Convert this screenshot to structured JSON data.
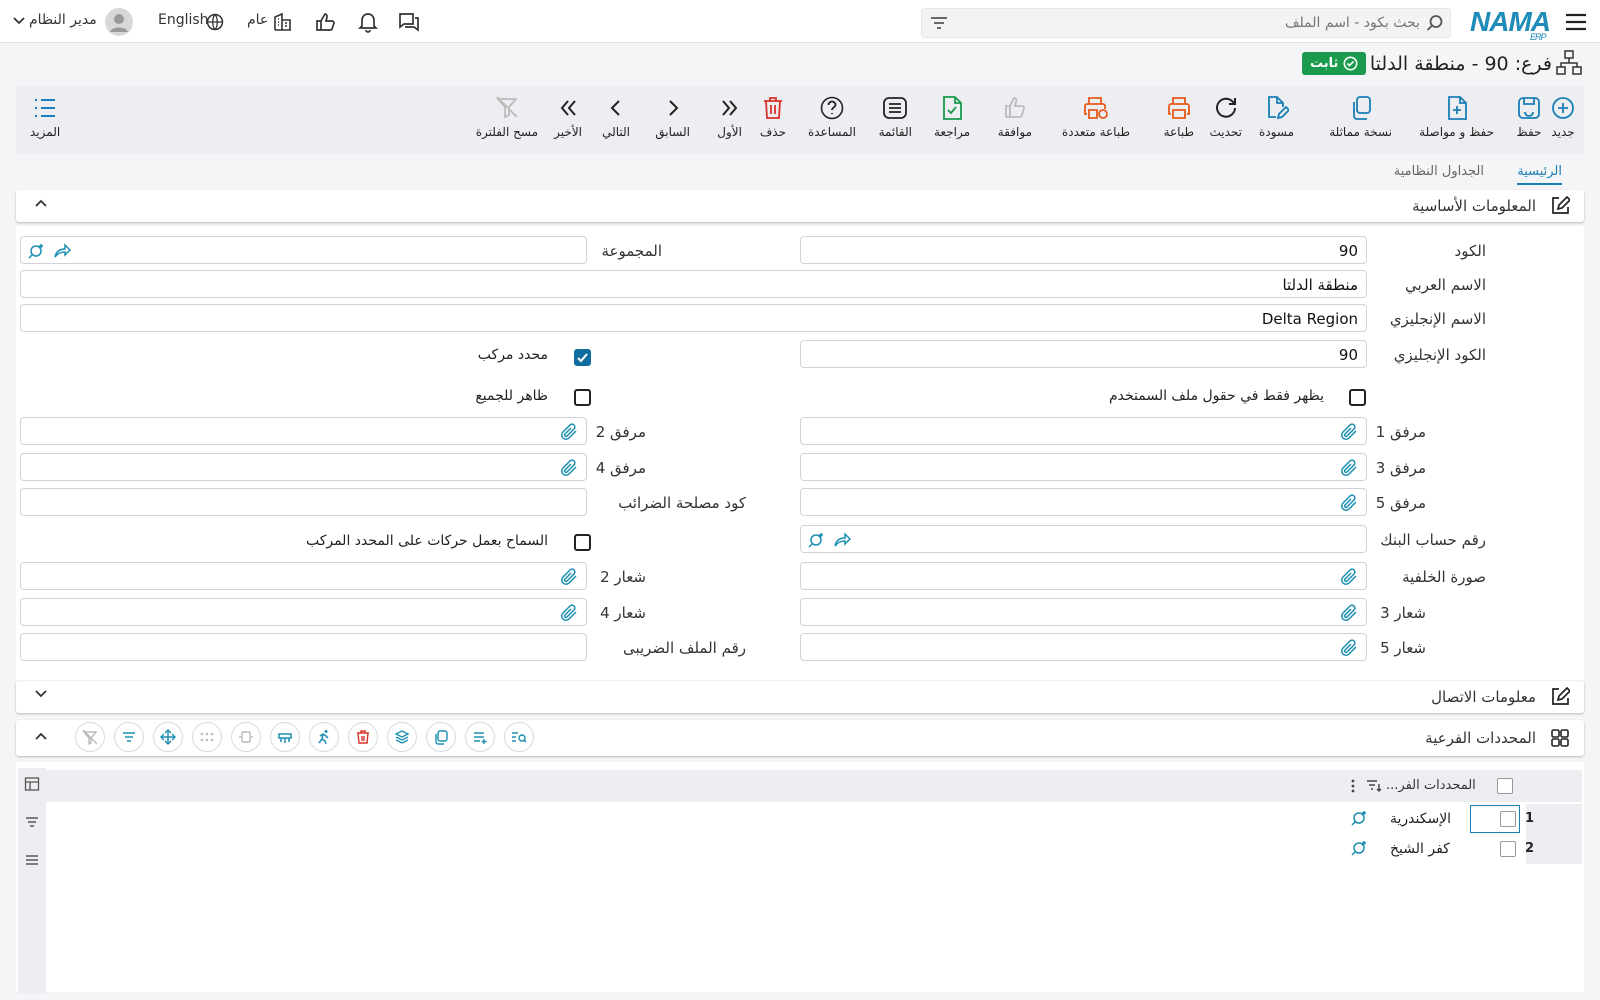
{
  "topbar": {
    "search_placeholder": "بحث بكود - اسم الملف",
    "user_name": "مدير النظام",
    "language": "English",
    "branch": "عام",
    "logo": "NAMA",
    "logo_sub": "ERP"
  },
  "page": {
    "title": "فرع: 90 - منطقة الدلتا",
    "status_badge": "ثابت"
  },
  "toolbar": {
    "new": "جديد",
    "save": "حفظ",
    "save_continue": "حفظ و مواصلة",
    "duplicate": "نسخة مماثلة",
    "draft": "مسودة",
    "refresh": "تحديث",
    "print": "طباعة",
    "multi_print": "طباعة متعددة",
    "approve": "موافقة",
    "review": "مراجعة",
    "list": "القائمة",
    "help": "المساعدة",
    "delete": "حذف",
    "first": "الأول",
    "previous": "السابق",
    "next": "التالي",
    "last": "الأخير",
    "clear_filter": "مسح الفلترة",
    "more": "المزيد"
  },
  "tabs": [
    "الرئيسية",
    "الجداول النظامية"
  ],
  "sections": {
    "basic_info": "المعلومات الأساسية",
    "contact_info": "معلومات الاتصال",
    "sub_dimensions": "المحددات الفرعية"
  },
  "form": {
    "code_label": "الكود",
    "code_value": "90",
    "group_label": "المجموعة",
    "arabic_name_label": "الاسم العربي",
    "arabic_name_value": "منطقة الدلتا",
    "english_name_label": "الاسم الإنجليزي",
    "english_name_value": "Delta Region",
    "english_code_label": "الكود الإنجليزي",
    "english_code_value": "90",
    "composite_dim_label": "محدد مركب",
    "composite_dim_checked": true,
    "visible_all_label": "ظاهر للجميع",
    "visible_all_checked": false,
    "user_file_only_label": "يظهر فقط في حقول ملف السمتخدم",
    "user_file_only_checked": false,
    "attach1": "مرفق 1",
    "attach2": "مرفق 2",
    "attach3": "مرفق 3",
    "attach4": "مرفق 4",
    "attach5": "مرفق 5",
    "tax_authority_code": "كود مصلحة الضرائب",
    "bank_account": "رقم حساب البنك",
    "allow_composite_label": "السماح بعمل حركات على المحدد المركب",
    "allow_composite_checked": false,
    "background_image": "صورة الخلفية",
    "logo2": "شعار 2",
    "logo3": "شعار 3",
    "logo4": "شعار 4",
    "logo5": "شعار 5",
    "tax_file_number": "رقم الملف الضريبى"
  },
  "grid": {
    "column_header": "المحددات الفر...",
    "rows": [
      {
        "num": "1",
        "name": "الإسكندرية"
      },
      {
        "num": "2",
        "name": "كفر الشيخ"
      }
    ]
  },
  "colors": {
    "accent": "#1a7fb5",
    "status_green": "#1a9a4d",
    "orange": "#e8591a",
    "red": "#d9322b",
    "teal": "#1a8fb0"
  }
}
